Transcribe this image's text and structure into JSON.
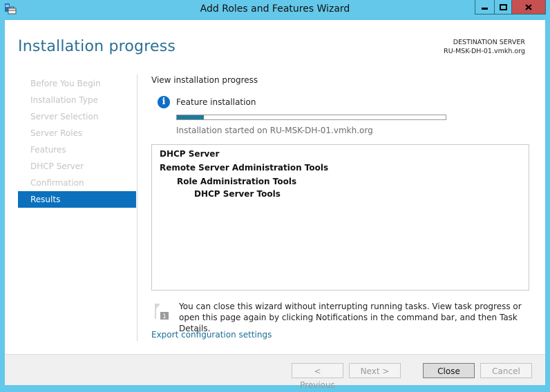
{
  "window": {
    "title": "Add Roles and Features Wizard",
    "icon": "server-manager-icon",
    "controls": {
      "minimize": "minimize-icon",
      "maximize": "maximize-icon",
      "close": "close-icon"
    }
  },
  "header": {
    "page_title": "Installation progress",
    "destination_label": "DESTINATION SERVER",
    "destination_server": "RU-MSK-DH-01.vmkh.org"
  },
  "nav": {
    "items": [
      {
        "label": "Before You Begin",
        "active": false
      },
      {
        "label": "Installation Type",
        "active": false
      },
      {
        "label": "Server Selection",
        "active": false
      },
      {
        "label": "Server Roles",
        "active": false
      },
      {
        "label": "Features",
        "active": false
      },
      {
        "label": "DHCP Server",
        "active": false
      },
      {
        "label": "Confirmation",
        "active": false
      },
      {
        "label": "Results",
        "active": true
      }
    ]
  },
  "main": {
    "lead": "View installation progress",
    "status_icon": "info-icon",
    "feature_label": "Feature installation",
    "progress_percent": 10,
    "started_text": "Installation started on RU-MSK-DH-01.vmkh.org",
    "results": [
      {
        "text": "DHCP Server",
        "level": 0
      },
      {
        "text": "Remote Server Administration Tools",
        "level": 0
      },
      {
        "text": "Role Administration Tools",
        "level": 1
      },
      {
        "text": "DHCP Server Tools",
        "level": 2
      }
    ],
    "notice_icon": "notification-flag-icon",
    "notice_badge": "1",
    "notice_text": "You can close this wizard without interrupting running tasks. View task progress or open this page again by clicking Notifications in the command bar, and then Task Details.",
    "export_link": "Export configuration settings"
  },
  "footer": {
    "previous": "< Previous",
    "next": "Next >",
    "close": "Close",
    "cancel": "Cancel"
  },
  "colors": {
    "frame": "#63c8ea",
    "accent": "#0b71bd",
    "title_text": "#2a6f93",
    "progress": "#1e7a9c",
    "close_button": "#c75050",
    "link": "#1a6e96"
  }
}
